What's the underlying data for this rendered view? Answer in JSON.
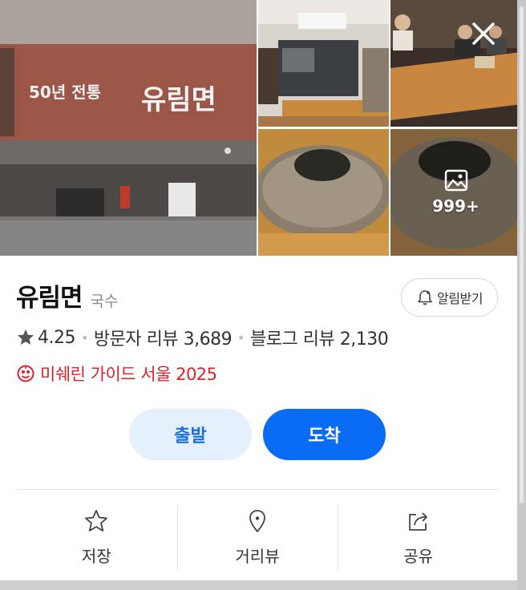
{
  "gallery": {
    "main_photo": {
      "signs": {
        "tradition": "50년 전통",
        "name": "유림면"
      }
    },
    "more_count": "999+"
  },
  "place": {
    "name": "유림면",
    "category": "국수"
  },
  "alarm": {
    "label": "알림받기"
  },
  "stats": {
    "rating": "4.25",
    "visitor_reviews": "방문자 리뷰 3,689",
    "blog_reviews": "블로그 리뷰 2,130"
  },
  "michelin": {
    "label": "미쉐린 가이드 서울 2025"
  },
  "route": {
    "depart": "출발",
    "arrive": "도착"
  },
  "actions": {
    "save": "저장",
    "street_view": "거리뷰",
    "share": "공유"
  },
  "colors": {
    "primary_blue": "#0a6cf4",
    "depart_bg": "#e5f0fd",
    "michelin_red": "#d8232a"
  },
  "icons": [
    "close-icon",
    "gallery-icon",
    "bell-icon",
    "star-icon",
    "michelin-icon",
    "star-outline-icon",
    "location-pin-icon",
    "share-icon"
  ]
}
